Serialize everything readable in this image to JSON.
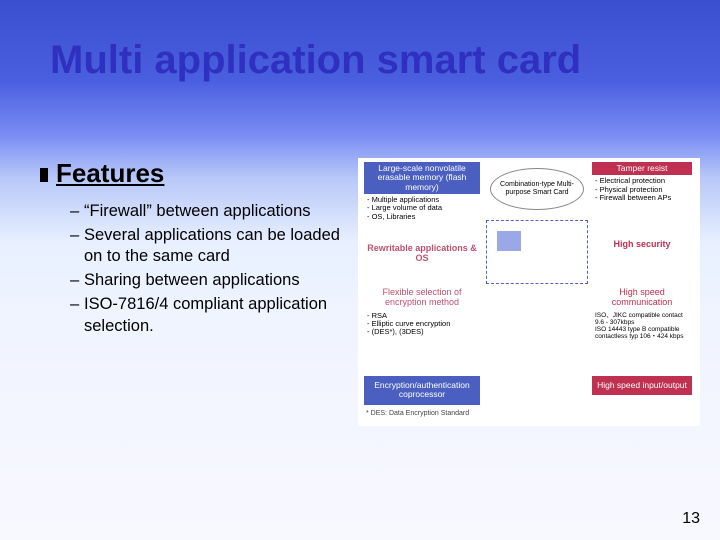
{
  "title": "Multi application smart card",
  "section_head": "Features",
  "features": [
    "“Firewall” between applications",
    "Several applications can be loaded on to the same card",
    "Sharing between applications",
    "ISO-7816/4 compliant application selection."
  ],
  "page_number": "13",
  "diagram": {
    "col1": {
      "b1_head": "Large-scale nonvolatile erasable memory (flash memory)",
      "b1_body": "- Multiple applications\n- Large volume of data\n- OS, Libraries",
      "b2_head": "Rewritable applications & OS",
      "b3_head": "Flexible selection of encryption method",
      "b3_body": "- RSA\n- Elliptic curve encryption\n- (DES*), (3DES)",
      "b4_head": "Encryption/authentication coprocessor"
    },
    "center": {
      "oval_top": "Combination-type Multi-purpose Smart Card"
    },
    "col2": {
      "b1_head": "Tamper resist",
      "b1_body": "- Electrical protection\n- Physical protection\n- Firewall between APs",
      "b2_head": "High security",
      "b3_head": "High speed communication",
      "b3_body": "ISO、JIKC compatible contact    9.6 - 307kbps\nISO 14443 type B compatible contactless typ    106・424 kbps",
      "b4_head": "High speed input/output"
    },
    "footnote": "* DES: Data Encryption Standard"
  }
}
